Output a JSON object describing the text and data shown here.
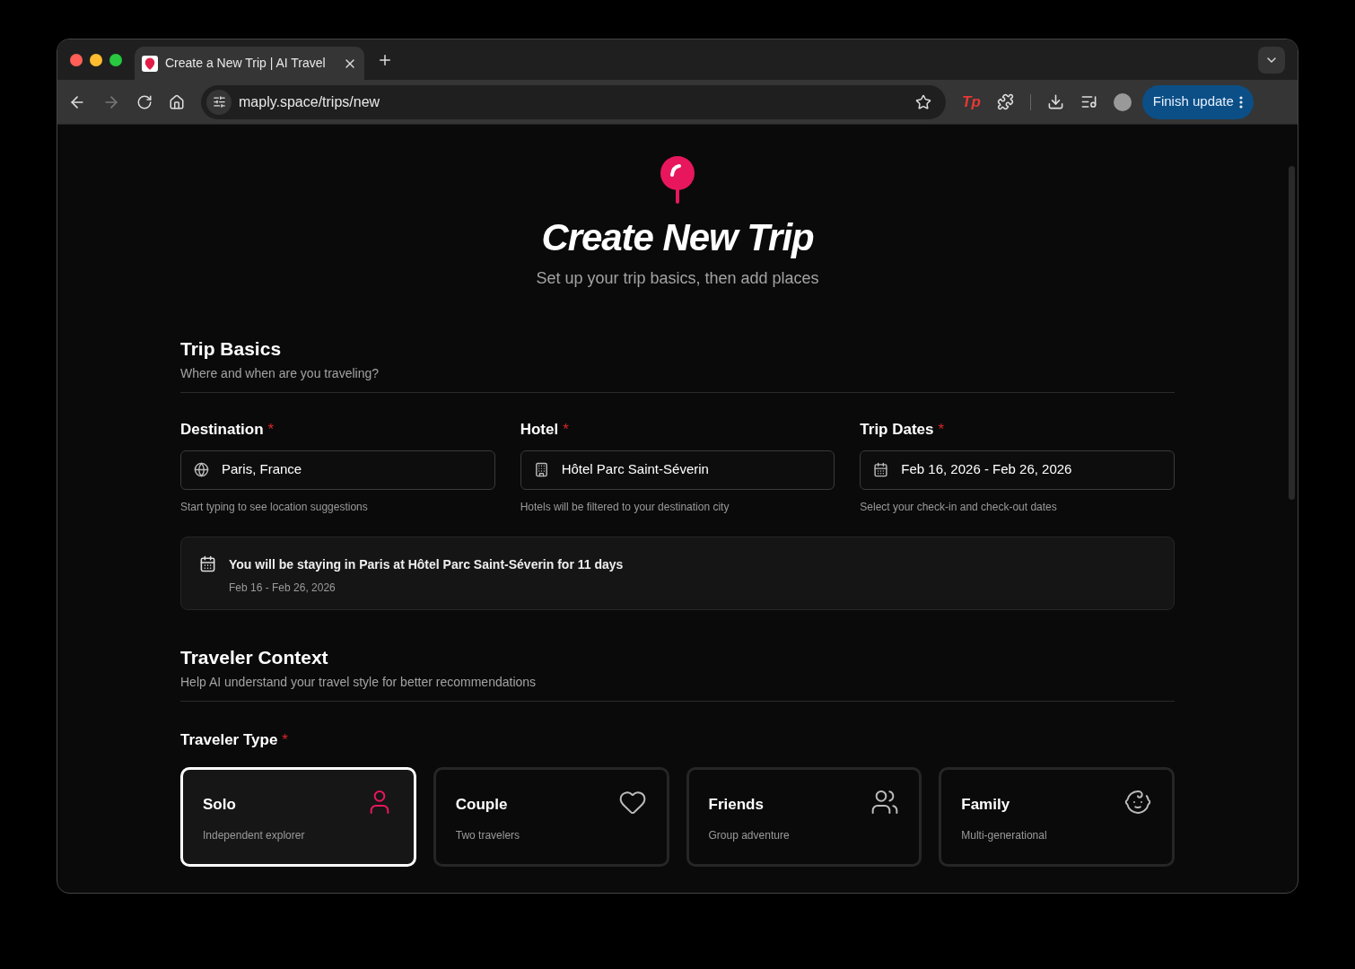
{
  "browser": {
    "tab_title": "Create a New Trip | AI Travel",
    "url": "maply.space/trips/new",
    "update_button": "Finish update",
    "extension_label": "Tp"
  },
  "header": {
    "title": "Create New Trip",
    "subtitle": "Set up your trip basics, then add places"
  },
  "basics": {
    "title": "Trip Basics",
    "subtitle": "Where and when are you traveling?",
    "fields": [
      {
        "kind": "destination",
        "label": "Destination",
        "required": "*",
        "value": "Paris, France",
        "hint": "Start typing to see location suggestions"
      },
      {
        "kind": "hotel",
        "label": "Hotel",
        "required": "*",
        "value": "Hôtel Parc Saint-Séverin",
        "hint": "Hotels will be filtered to your destination city"
      },
      {
        "kind": "dates",
        "label": "Trip Dates",
        "required": "*",
        "value": "Feb 16, 2026 - Feb 26, 2026",
        "hint": "Select your check-in and check-out dates"
      }
    ],
    "summary": {
      "text": "You will be staying in **Paris** at **Hôtel Parc Saint-Séverin** for **11 days**",
      "dates": "Feb 16 - Feb 26, 2026"
    }
  },
  "context": {
    "title": "Traveler Context",
    "subtitle": "Help AI understand your travel style for better recommendations",
    "type_label": "Traveler Type",
    "required": "*",
    "types": [
      {
        "kind": "solo",
        "label": "Solo",
        "description": "Independent explorer",
        "selected": true
      },
      {
        "kind": "couple",
        "label": "Couple",
        "description": "Two travelers",
        "selected": false
      },
      {
        "kind": "friends",
        "label": "Friends",
        "description": "Group adventure",
        "selected": false
      },
      {
        "kind": "family",
        "label": "Family",
        "description": "Multi-generational",
        "selected": false
      }
    ]
  }
}
